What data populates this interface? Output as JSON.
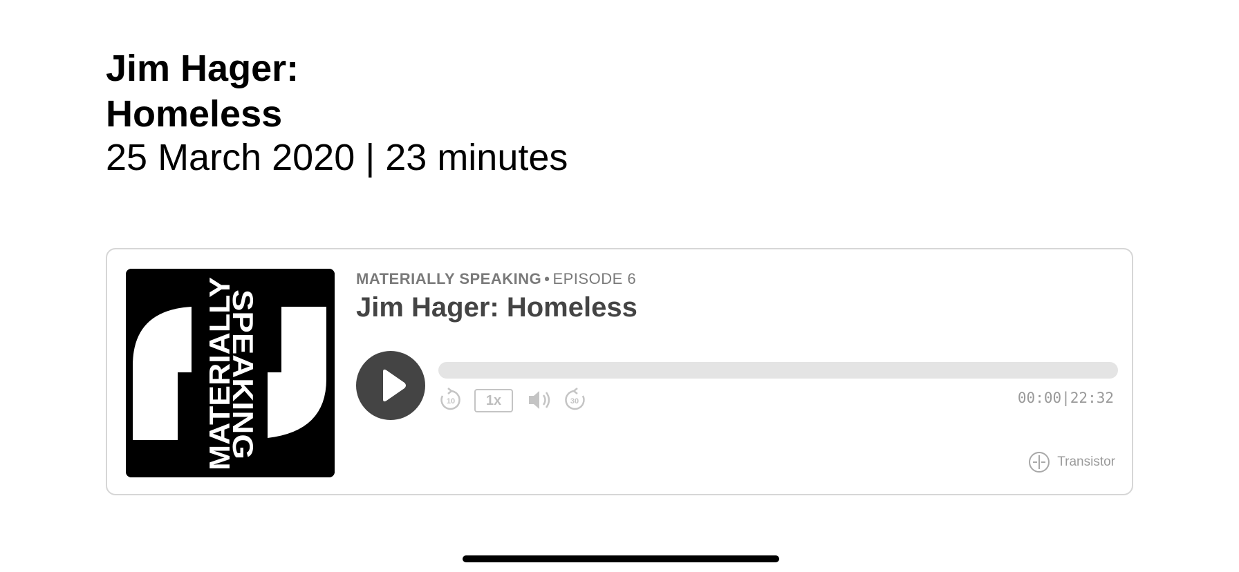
{
  "episode": {
    "title": "Jim Hager: Homeless",
    "meta": "25 March 2020 | 23 minutes"
  },
  "player": {
    "show_name": "MATERIALLY SPEAKING",
    "separator": "•",
    "episode_label": "EPISODE 6",
    "title": "Jim Hager: Homeless",
    "artwork_text_left": "MATERIALLY",
    "artwork_text_right": "SPEAKING",
    "speed": "1x",
    "time_current": "00:00",
    "time_divider": "|",
    "time_total": "22:32",
    "progress": 0,
    "rewind_seconds": "10",
    "forward_seconds": "30",
    "brand": "Transistor",
    "icons": {
      "play": "play-icon",
      "rewind": "rewind-10-icon",
      "volume": "volume-icon",
      "forward": "forward-30-icon",
      "brand": "transistor-logo-icon"
    }
  }
}
